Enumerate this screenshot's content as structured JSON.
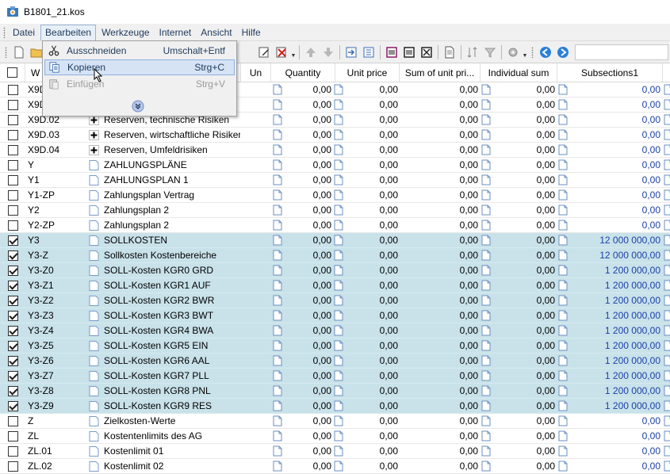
{
  "window": {
    "title": "B1801_21.kos"
  },
  "menubar": {
    "items": [
      "Datei",
      "Bearbeiten",
      "Werkzeuge",
      "Internet",
      "Ansicht",
      "Hilfe"
    ]
  },
  "dropdown": {
    "items": [
      {
        "label": "Ausschneiden",
        "shortcut": "Umschalt+Entf",
        "icon": "scissors-icon"
      },
      {
        "label": "Kopieren",
        "shortcut": "Strg+C",
        "icon": "copy-icon"
      },
      {
        "label": "Einfügen",
        "shortcut": "Strg+V",
        "icon": "paste-icon"
      }
    ]
  },
  "columns": {
    "w": "W",
    "un": "Un",
    "quantity": "Quantity",
    "unit_price": "Unit price",
    "sum_unit": "Sum of unit pri...",
    "individual": "Individual sum",
    "subsections": "Subsections1"
  },
  "rows": [
    {
      "code": "X9D",
      "desc": "",
      "checked": false,
      "qty": "0,00",
      "price": "0,00",
      "sum": "0,00",
      "ind": "0,00",
      "sub": "0,00",
      "icon": "none"
    },
    {
      "code": "X9D",
      "desc": "",
      "checked": false,
      "qty": "0,00",
      "price": "0,00",
      "sum": "0,00",
      "ind": "0,00",
      "sub": "0,00",
      "icon": "none"
    },
    {
      "code": "X9D.02",
      "desc": "Reserven, technische Risiken",
      "checked": false,
      "qty": "0,00",
      "price": "0,00",
      "sum": "0,00",
      "ind": "0,00",
      "sub": "0,00",
      "icon": "plus"
    },
    {
      "code": "X9D.03",
      "desc": "Reserven, wirtschaftliche Risiken",
      "checked": false,
      "qty": "0,00",
      "price": "0,00",
      "sum": "0,00",
      "ind": "0,00",
      "sub": "0,00",
      "icon": "plus"
    },
    {
      "code": "X9D.04",
      "desc": "Reserven, Umfeldrisiken",
      "checked": false,
      "qty": "0,00",
      "price": "0,00",
      "sum": "0,00",
      "ind": "0,00",
      "sub": "0,00",
      "icon": "plus"
    },
    {
      "code": "Y",
      "desc": "ZAHLUNGSPLÄNE",
      "checked": false,
      "qty": "0,00",
      "price": "0,00",
      "sum": "0,00",
      "ind": "0,00",
      "sub": "0,00",
      "icon": "doc"
    },
    {
      "code": "Y1",
      "desc": "ZAHLUNGSPLAN 1",
      "checked": false,
      "qty": "0,00",
      "price": "0,00",
      "sum": "0,00",
      "ind": "0,00",
      "sub": "0,00",
      "icon": "doc"
    },
    {
      "code": "Y1-ZP",
      "desc": "Zahlungsplan Vertrag",
      "checked": false,
      "qty": "0,00",
      "price": "0,00",
      "sum": "0,00",
      "ind": "0,00",
      "sub": "0,00",
      "icon": "doc"
    },
    {
      "code": "Y2",
      "desc": "Zahlungsplan 2",
      "checked": false,
      "qty": "0,00",
      "price": "0,00",
      "sum": "0,00",
      "ind": "0,00",
      "sub": "0,00",
      "icon": "doc"
    },
    {
      "code": "Y2-ZP",
      "desc": "Zahlungsplan 2",
      "checked": false,
      "qty": "0,00",
      "price": "0,00",
      "sum": "0,00",
      "ind": "0,00",
      "sub": "0,00",
      "icon": "doc"
    },
    {
      "code": "Y3",
      "desc": "SOLLKOSTEN",
      "checked": true,
      "qty": "0,00",
      "price": "0,00",
      "sum": "0,00",
      "ind": "0,00",
      "sub": "12 000 000,00",
      "icon": "doc"
    },
    {
      "code": "Y3-Z",
      "desc": "Sollkosten Kostenbereiche",
      "checked": true,
      "qty": "0,00",
      "price": "0,00",
      "sum": "0,00",
      "ind": "0,00",
      "sub": "12 000 000,00",
      "icon": "doc"
    },
    {
      "code": "Y3-Z0",
      "desc": "SOLL-Kosten KGR0 GRD",
      "checked": true,
      "qty": "0,00",
      "price": "0,00",
      "sum": "0,00",
      "ind": "0,00",
      "sub": "1 200 000,00",
      "icon": "doc"
    },
    {
      "code": "Y3-Z1",
      "desc": "SOLL-Kosten KGR1 AUF",
      "checked": true,
      "qty": "0,00",
      "price": "0,00",
      "sum": "0,00",
      "ind": "0,00",
      "sub": "1 200 000,00",
      "icon": "doc"
    },
    {
      "code": "Y3-Z2",
      "desc": "SOLL-Kosten KGR2 BWR",
      "checked": true,
      "qty": "0,00",
      "price": "0,00",
      "sum": "0,00",
      "ind": "0,00",
      "sub": "1 200 000,00",
      "icon": "doc"
    },
    {
      "code": "Y3-Z3",
      "desc": "SOLL-Kosten KGR3 BWT",
      "checked": true,
      "qty": "0,00",
      "price": "0,00",
      "sum": "0,00",
      "ind": "0,00",
      "sub": "1 200 000,00",
      "icon": "doc"
    },
    {
      "code": "Y3-Z4",
      "desc": "SOLL-Kosten KGR4 BWA",
      "checked": true,
      "qty": "0,00",
      "price": "0,00",
      "sum": "0,00",
      "ind": "0,00",
      "sub": "1 200 000,00",
      "icon": "doc"
    },
    {
      "code": "Y3-Z5",
      "desc": "SOLL-Kosten KGR5 EIN",
      "checked": true,
      "qty": "0,00",
      "price": "0,00",
      "sum": "0,00",
      "ind": "0,00",
      "sub": "1 200 000,00",
      "icon": "doc"
    },
    {
      "code": "Y3-Z6",
      "desc": "SOLL-Kosten KGR6 AAL",
      "checked": true,
      "qty": "0,00",
      "price": "0,00",
      "sum": "0,00",
      "ind": "0,00",
      "sub": "1 200 000,00",
      "icon": "doc"
    },
    {
      "code": "Y3-Z7",
      "desc": "SOLL-Kosten KGR7 PLL",
      "checked": true,
      "qty": "0,00",
      "price": "0,00",
      "sum": "0,00",
      "ind": "0,00",
      "sub": "1 200 000,00",
      "icon": "doc"
    },
    {
      "code": "Y3-Z8",
      "desc": "SOLL-Kosten KGR8 PNL",
      "checked": true,
      "qty": "0,00",
      "price": "0,00",
      "sum": "0,00",
      "ind": "0,00",
      "sub": "1 200 000,00",
      "icon": "doc"
    },
    {
      "code": "Y3-Z9",
      "desc": "SOLL-Kosten KGR9 RES",
      "checked": true,
      "qty": "0,00",
      "price": "0,00",
      "sum": "0,00",
      "ind": "0,00",
      "sub": "1 200 000,00",
      "icon": "doc"
    },
    {
      "code": "Z",
      "desc": "Zielkosten-Werte",
      "checked": false,
      "qty": "0,00",
      "price": "0,00",
      "sum": "0,00",
      "ind": "0,00",
      "sub": "0,00",
      "icon": "doc"
    },
    {
      "code": "ZL",
      "desc": "Kostentenlimits des AG",
      "checked": false,
      "qty": "0,00",
      "price": "0,00",
      "sum": "0,00",
      "ind": "0,00",
      "sub": "0,00",
      "icon": "doc"
    },
    {
      "code": "ZL.01",
      "desc": "Kostenlimit 01",
      "checked": false,
      "qty": "0,00",
      "price": "0,00",
      "sum": "0,00",
      "ind": "0,00",
      "sub": "0,00",
      "icon": "doc"
    },
    {
      "code": "ZL.02",
      "desc": "Kostenlimit 02",
      "checked": false,
      "qty": "0,00",
      "price": "0,00",
      "sum": "0,00",
      "ind": "0,00",
      "sub": "0,00",
      "icon": "doc"
    }
  ],
  "colors": {
    "checked_row": "#c9e2ea",
    "subsection_text": "#1a3fa8",
    "menu_text": "#1e395b"
  }
}
